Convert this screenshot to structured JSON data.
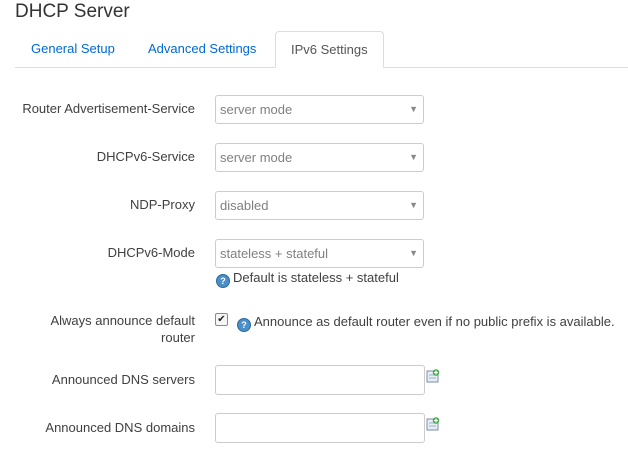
{
  "page": {
    "title": "DHCP Server"
  },
  "tabs": [
    {
      "label": "General Setup"
    },
    {
      "label": "Advanced Settings"
    },
    {
      "label": "IPv6 Settings",
      "active": true
    }
  ],
  "fields": {
    "ra_service": {
      "label": "Router Advertisement-Service",
      "value": "server mode"
    },
    "dhcpv6_service": {
      "label": "DHCPv6-Service",
      "value": "server mode"
    },
    "ndp_proxy": {
      "label": "NDP-Proxy",
      "value": "disabled"
    },
    "dhcpv6_mode": {
      "label": "DHCPv6-Mode",
      "value": "stateless + stateful",
      "help": "Default is stateless + stateful"
    },
    "always_announce": {
      "label_line1": "Always announce default",
      "label_line2": "router",
      "checked": true,
      "help": "Announce as default router even if no public prefix is available."
    },
    "dns_servers": {
      "label": "Announced DNS servers",
      "value": ""
    },
    "dns_domains": {
      "label": "Announced DNS domains",
      "value": ""
    }
  },
  "icons": {
    "dropdown": "dropdown-arrow-icon",
    "help": "help-icon",
    "add": "add-entry-icon",
    "check": "checkmark-icon"
  },
  "colors": {
    "link": "#0069d6",
    "text": "#404040",
    "border": "#cccccc"
  }
}
